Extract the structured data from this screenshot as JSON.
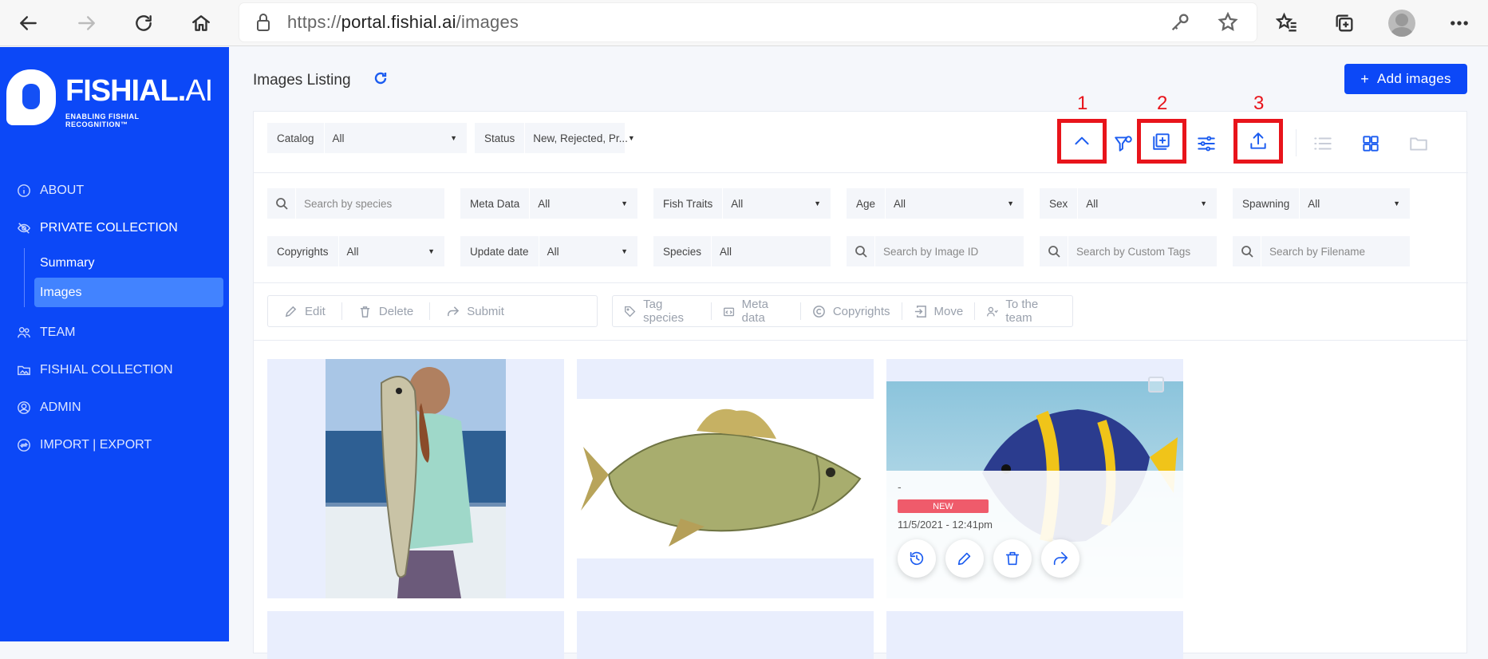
{
  "browser": {
    "url_prefix": "https://",
    "url_host": "portal.fishial.ai",
    "url_path": "/images"
  },
  "sidebar": {
    "brand_bold": "FISHIAL.",
    "brand_light": "AI",
    "tagline": "ENABLING FISHIAL RECOGNITION™",
    "items": [
      {
        "label": "ABOUT",
        "icon": "info-icon"
      },
      {
        "label": "PRIVATE COLLECTION",
        "icon": "eye-slash-icon"
      },
      {
        "label": "TEAM",
        "icon": "team-icon"
      },
      {
        "label": "FISHIAL COLLECTION",
        "icon": "folder-image-icon"
      },
      {
        "label": "ADMIN",
        "icon": "user-circle-icon"
      },
      {
        "label": "IMPORT | EXPORT",
        "icon": "sync-icon"
      }
    ],
    "submenu": [
      {
        "label": "Summary"
      },
      {
        "label": "Images",
        "selected": true
      }
    ]
  },
  "main": {
    "title": "Images Listing",
    "add_button": "Add images",
    "annotations": [
      "1",
      "2",
      "3"
    ],
    "filters_top": {
      "catalog": {
        "label": "Catalog",
        "value": "All"
      },
      "status": {
        "label": "Status",
        "value": "New, Rejected, Pr..."
      }
    },
    "filters": {
      "species_search": {
        "placeholder": "Search by species"
      },
      "meta": {
        "label": "Meta Data",
        "value": "All"
      },
      "traits": {
        "label": "Fish Traits",
        "value": "All"
      },
      "age": {
        "label": "Age",
        "value": "All"
      },
      "sex": {
        "label": "Sex",
        "value": "All"
      },
      "spawning": {
        "label": "Spawning",
        "value": "All"
      },
      "copyrights": {
        "label": "Copyrights",
        "value": "All"
      },
      "update_date": {
        "label": "Update date",
        "value": "All"
      },
      "species": {
        "label": "Species",
        "value": "All"
      },
      "image_id_search": {
        "placeholder": "Search by Image ID"
      },
      "custom_tags_search": {
        "placeholder": "Search by Custom Tags"
      },
      "filename_search": {
        "placeholder": "Search by Filename"
      }
    },
    "actions_left": [
      "Edit",
      "Delete",
      "Submit"
    ],
    "actions_right": [
      "Tag species",
      "Meta data",
      "Copyrights",
      "Move",
      "To the team"
    ],
    "card3": {
      "name": "-",
      "status": "NEW",
      "date": "11/5/2021 - 12:41pm"
    }
  },
  "colors": {
    "sidebar": "#0c48f7",
    "accent": "#1b5cf0",
    "annotation": "#e8141b",
    "badge_new": "#ef5b6b"
  }
}
